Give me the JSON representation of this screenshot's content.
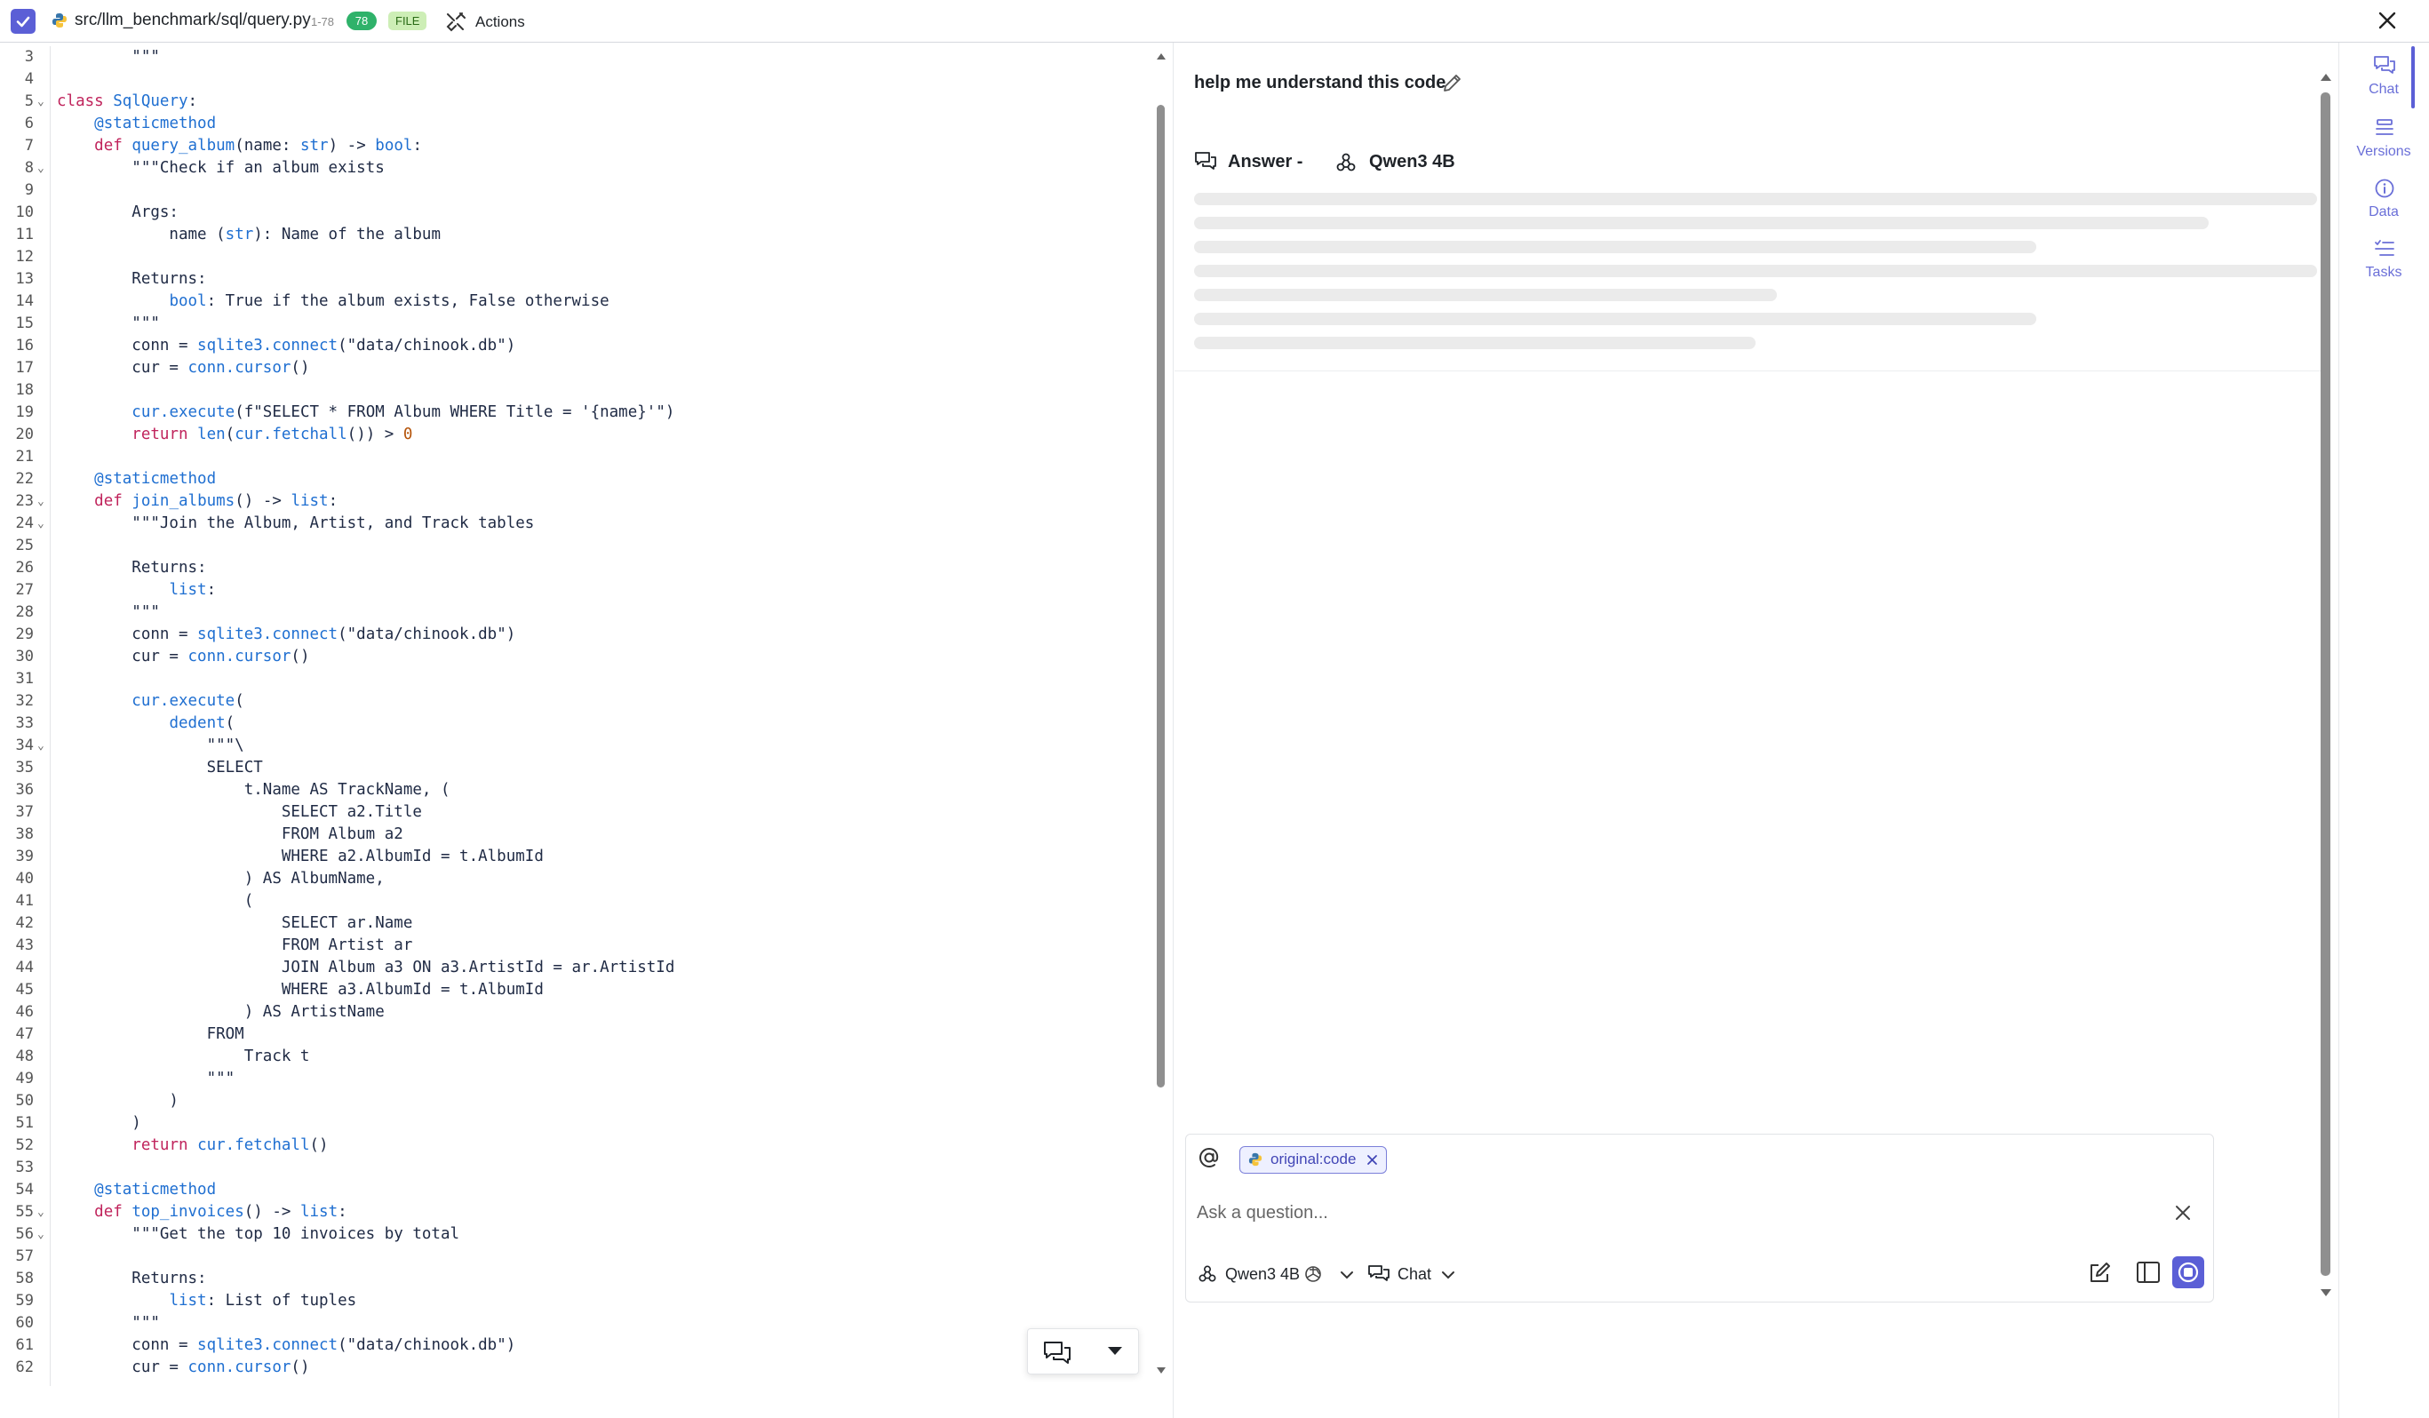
{
  "topbar": {
    "file_path": "src/llm_benchmark/sql/query.py",
    "range": "1-78",
    "line_count": "78",
    "file_badge": "FILE",
    "actions_label": "Actions"
  },
  "editor": {
    "lines": [
      {
        "n": "3",
        "t": "        \"\"\""
      },
      {
        "n": "4",
        "t": ""
      },
      {
        "n": "5",
        "t": "class SqlQuery:"
      },
      {
        "n": "6",
        "t": "    @staticmethod"
      },
      {
        "n": "7",
        "t": "    def query_album(name: str) -> bool:"
      },
      {
        "n": "8",
        "t": "        \"\"\"Check if an album exists"
      },
      {
        "n": "9",
        "t": ""
      },
      {
        "n": "10",
        "t": "        Args:"
      },
      {
        "n": "11",
        "t": "            name (str): Name of the album"
      },
      {
        "n": "12",
        "t": ""
      },
      {
        "n": "13",
        "t": "        Returns:"
      },
      {
        "n": "14",
        "t": "            bool: True if the album exists, False otherwise"
      },
      {
        "n": "15",
        "t": "        \"\"\""
      },
      {
        "n": "16",
        "t": "        conn = sqlite3.connect(\"data/chinook.db\")"
      },
      {
        "n": "17",
        "t": "        cur = conn.cursor()"
      },
      {
        "n": "18",
        "t": ""
      },
      {
        "n": "19",
        "t": "        cur.execute(f\"SELECT * FROM Album WHERE Title = '{name}'\")"
      },
      {
        "n": "20",
        "t": "        return len(cur.fetchall()) > 0"
      },
      {
        "n": "21",
        "t": ""
      },
      {
        "n": "22",
        "t": "    @staticmethod"
      },
      {
        "n": "23",
        "t": "    def join_albums() -> list:"
      },
      {
        "n": "24",
        "t": "        \"\"\"Join the Album, Artist, and Track tables"
      },
      {
        "n": "25",
        "t": ""
      },
      {
        "n": "26",
        "t": "        Returns:"
      },
      {
        "n": "27",
        "t": "            list:"
      },
      {
        "n": "28",
        "t": "        \"\"\""
      },
      {
        "n": "29",
        "t": "        conn = sqlite3.connect(\"data/chinook.db\")"
      },
      {
        "n": "30",
        "t": "        cur = conn.cursor()"
      },
      {
        "n": "31",
        "t": ""
      },
      {
        "n": "32",
        "t": "        cur.execute("
      },
      {
        "n": "33",
        "t": "            dedent("
      },
      {
        "n": "34",
        "t": "                \"\"\"\\"
      },
      {
        "n": "35",
        "t": "                SELECT"
      },
      {
        "n": "36",
        "t": "                    t.Name AS TrackName, ("
      },
      {
        "n": "37",
        "t": "                        SELECT a2.Title"
      },
      {
        "n": "38",
        "t": "                        FROM Album a2"
      },
      {
        "n": "39",
        "t": "                        WHERE a2.AlbumId = t.AlbumId"
      },
      {
        "n": "40",
        "t": "                    ) AS AlbumName,"
      },
      {
        "n": "41",
        "t": "                    ("
      },
      {
        "n": "42",
        "t": "                        SELECT ar.Name"
      },
      {
        "n": "43",
        "t": "                        FROM Artist ar"
      },
      {
        "n": "44",
        "t": "                        JOIN Album a3 ON a3.ArtistId = ar.ArtistId"
      },
      {
        "n": "45",
        "t": "                        WHERE a3.AlbumId = t.AlbumId"
      },
      {
        "n": "46",
        "t": "                    ) AS ArtistName"
      },
      {
        "n": "47",
        "t": "                FROM"
      },
      {
        "n": "48",
        "t": "                    Track t"
      },
      {
        "n": "49",
        "t": "                \"\"\""
      },
      {
        "n": "50",
        "t": "            )"
      },
      {
        "n": "51",
        "t": "        )"
      },
      {
        "n": "52",
        "t": "        return cur.fetchall()"
      },
      {
        "n": "53",
        "t": ""
      },
      {
        "n": "54",
        "t": "    @staticmethod"
      },
      {
        "n": "55",
        "t": "    def top_invoices() -> list:"
      },
      {
        "n": "56",
        "t": "        \"\"\"Get the top 10 invoices by total"
      },
      {
        "n": "57",
        "t": ""
      },
      {
        "n": "58",
        "t": "        Returns:"
      },
      {
        "n": "59",
        "t": "            list: List of tuples"
      },
      {
        "n": "60",
        "t": "        \"\"\""
      },
      {
        "n": "61",
        "t": "        conn = sqlite3.connect(\"data/chinook.db\")"
      },
      {
        "n": "62",
        "t": "        cur = conn.cursor()"
      }
    ],
    "folded_lines": [
      "5",
      "8",
      "23",
      "24",
      "34",
      "55",
      "56"
    ]
  },
  "chat": {
    "question": "help me understand this code",
    "answer_label": "Answer -",
    "model_name": "Qwen3 4B",
    "context_chip": "original:code",
    "input_placeholder": "Ask a question...",
    "model_selector": "Qwen3 4B",
    "mode_selector": "Chat"
  },
  "rail": {
    "items": [
      {
        "label": "Chat",
        "icon": "chat-icon"
      },
      {
        "label": "Versions",
        "icon": "versions-icon"
      },
      {
        "label": "Data",
        "icon": "info-icon"
      },
      {
        "label": "Tasks",
        "icon": "tasks-icon"
      }
    ]
  },
  "colors": {
    "accent": "#5b5fd6",
    "keyword": "#c0245c",
    "identifier": "#1f6fd1",
    "badge_green": "#2fb26a",
    "badge_file_bg": "#cdeeb6"
  }
}
